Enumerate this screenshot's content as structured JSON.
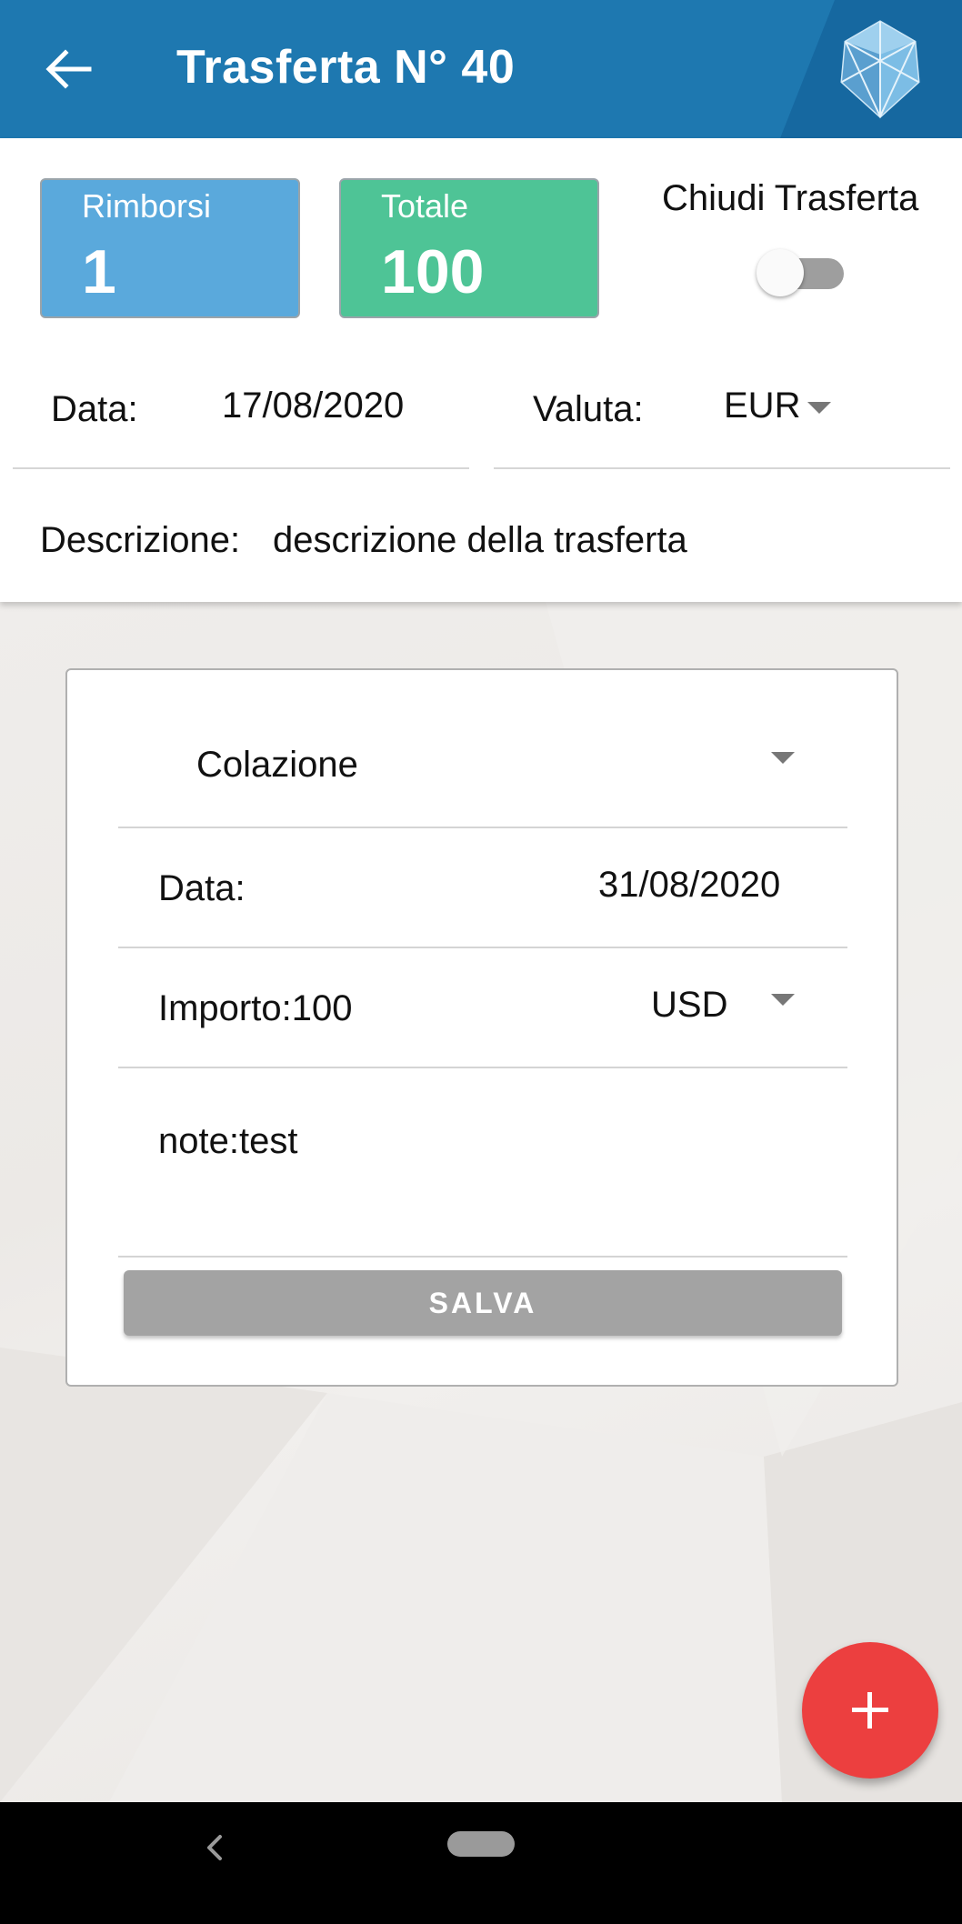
{
  "app_bar": {
    "title": "Trasferta N° 40",
    "back_icon": "arrow-left-icon",
    "logo_icon": "diamond-logo-icon",
    "color": "#1e78b0"
  },
  "summary": {
    "rimborsi_label": "Rimborsi",
    "rimborsi_value": "1",
    "rimborsi_color": "#5aa9dc",
    "totale_label": "Totale",
    "totale_value": "100",
    "totale_color": "#4ec496",
    "chiudi_label": "Chiudi Trasferta",
    "chiudi_on": false
  },
  "trip": {
    "data_label": "Data:",
    "data_value": "17/08/2020",
    "valuta_label": "Valuta:",
    "valuta_value": "EUR",
    "descrizione_label": "Descrizione:",
    "descrizione_value": "descrizione della trasferta"
  },
  "expense_form": {
    "category_value": "Colazione",
    "data_label": "Data:",
    "data_value": "31/08/2020",
    "importo_label": "Importo:",
    "importo_value": "100",
    "currency_value": "USD",
    "note_label": "note:",
    "note_value": "test",
    "save_label": "SALVA"
  },
  "fab": {
    "icon": "plus-icon",
    "color": "#ec3f3f"
  },
  "system_nav": {
    "back_icon": "nav-back-icon",
    "home_icon": "nav-home-pill-icon"
  }
}
